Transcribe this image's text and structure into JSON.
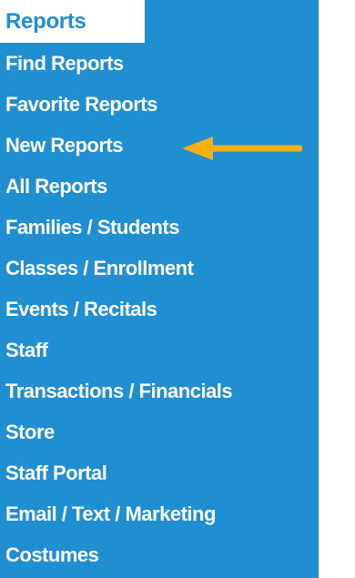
{
  "menu": {
    "header": "Reports",
    "items": [
      {
        "label": "Find Reports"
      },
      {
        "label": "Favorite Reports"
      },
      {
        "label": "New Reports"
      },
      {
        "label": "All Reports"
      },
      {
        "label": "Families / Students"
      },
      {
        "label": "Classes / Enrollment"
      },
      {
        "label": "Events / Recitals"
      },
      {
        "label": "Staff"
      },
      {
        "label": "Transactions / Financials"
      },
      {
        "label": "Store"
      },
      {
        "label": "Staff Portal"
      },
      {
        "label": "Email / Text / Marketing"
      },
      {
        "label": "Costumes"
      }
    ]
  },
  "annotation": {
    "icon": "arrow-left-icon",
    "color": "#f5b014"
  },
  "colors": {
    "panel": "#1f8fd1",
    "header_bg": "#ffffff",
    "item_text": "#ffffff"
  }
}
